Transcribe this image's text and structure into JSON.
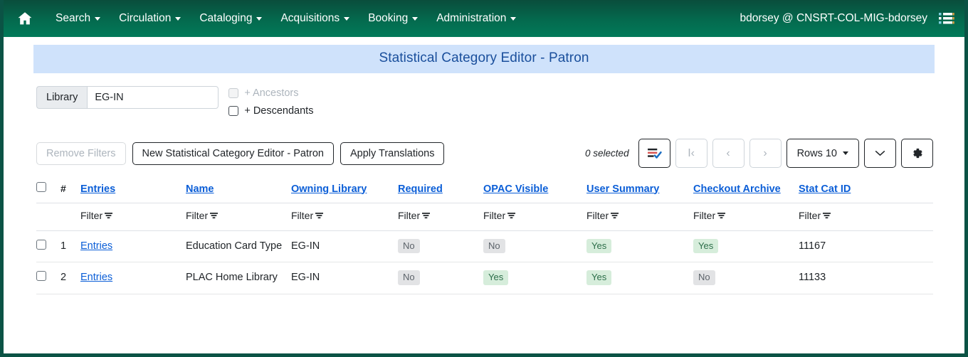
{
  "navbar": {
    "home_icon": "home-icon",
    "menu_icon": "list-menu-icon",
    "items": [
      {
        "label": "Search"
      },
      {
        "label": "Circulation"
      },
      {
        "label": "Cataloging"
      },
      {
        "label": "Acquisitions"
      },
      {
        "label": "Booking"
      },
      {
        "label": "Administration"
      }
    ],
    "user": "bdorsey @ CNSRT-COL-MIG-bdorsey",
    "bg_color": "#046a4e"
  },
  "page": {
    "title": "Statistical Category Editor - Patron",
    "title_bg": "#cfe2fb",
    "title_color": "#1a4f9c"
  },
  "filters": {
    "library_label": "Library",
    "library_value": "EG-IN",
    "library_placeholder": "",
    "ancestors_label": "+ Ancestors",
    "ancestors_checked": false,
    "ancestors_disabled": true,
    "descendants_label": "+ Descendants",
    "descendants_checked": false
  },
  "toolbar": {
    "remove_filters_label": "Remove Filters",
    "remove_filters_disabled": true,
    "new_record_label": "New Statistical Category Editor - Patron",
    "apply_translations_label": "Apply Translations",
    "selected_count": "0 selected",
    "select_actions_icon": "list-check-icon",
    "first_page_icon": "first-page-icon",
    "first_page_label": "I‹",
    "prev_page_icon": "chevron-left-icon",
    "prev_page_label": "‹",
    "next_page_icon": "chevron-right-icon",
    "next_page_label": "›",
    "rows_label": "Rows 10",
    "expand_icon": "chevron-down-icon",
    "expand_label": "⌄",
    "settings_icon": "gear-icon"
  },
  "table": {
    "filter_label": "Filter",
    "hash_label": "#",
    "columns": [
      {
        "label": "Entries"
      },
      {
        "label": "Name"
      },
      {
        "label": "Owning Library"
      },
      {
        "label": "Required"
      },
      {
        "label": "OPAC Visible"
      },
      {
        "label": "User Summary"
      },
      {
        "label": "Checkout Archive"
      },
      {
        "label": "Stat Cat ID"
      }
    ],
    "rows": [
      {
        "num": "1",
        "entries": "Entries",
        "name": "Education Card Type",
        "owning_library": "EG-IN",
        "required": "No",
        "opac_visible": "No",
        "user_summary": "Yes",
        "checkout_archive": "Yes",
        "stat_cat_id": "11167"
      },
      {
        "num": "2",
        "entries": "Entries",
        "name": "PLAC Home Library",
        "owning_library": "EG-IN",
        "required": "No",
        "opac_visible": "Yes",
        "user_summary": "Yes",
        "checkout_archive": "No",
        "stat_cat_id": "11133"
      }
    ]
  },
  "colors": {
    "link": "#0b5ed7",
    "badge_yes_bg": "#d6eddb",
    "badge_yes_fg": "#2c6e49",
    "badge_no_bg": "#e2e3e5",
    "badge_no_fg": "#5c636a"
  }
}
